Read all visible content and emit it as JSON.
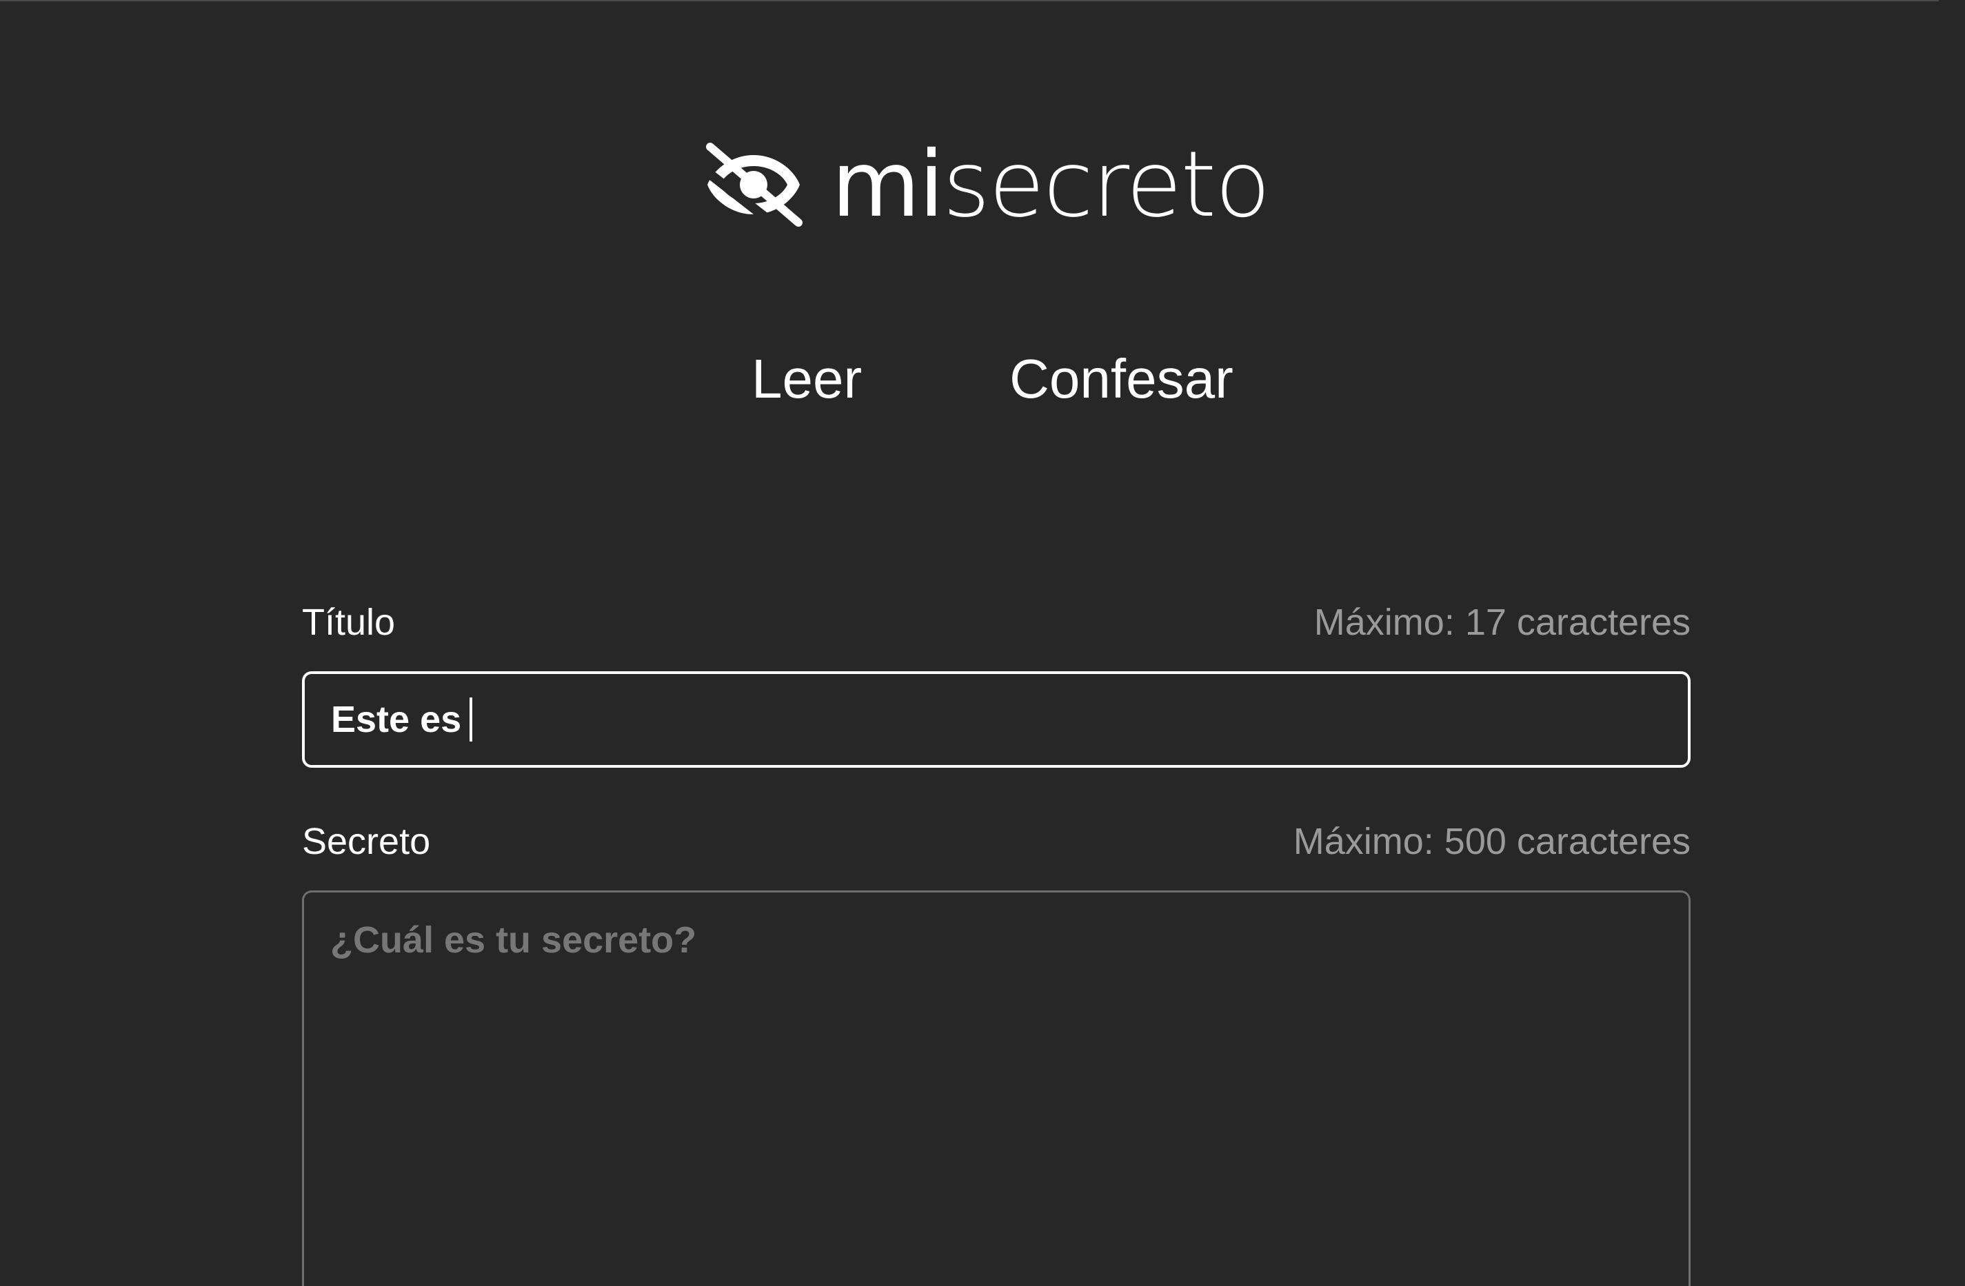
{
  "logo": {
    "icon": "eye-slash-icon",
    "prefix": "mi",
    "suffix": "secreto"
  },
  "nav": {
    "read_label": "Leer",
    "confess_label": "Confesar"
  },
  "form": {
    "title": {
      "label": "Título",
      "max_hint": "Máximo: 17 caracteres",
      "value": "Este es"
    },
    "secret": {
      "label": "Secreto",
      "max_hint": "Máximo: 500 caracteres",
      "placeholder": "¿Cuál es tu secreto?"
    }
  },
  "colors": {
    "background": "#272727",
    "text": "#ffffff",
    "muted": "#9a9a9a",
    "border_active": "#ffffff",
    "border_idle": "#6e6e6e"
  }
}
